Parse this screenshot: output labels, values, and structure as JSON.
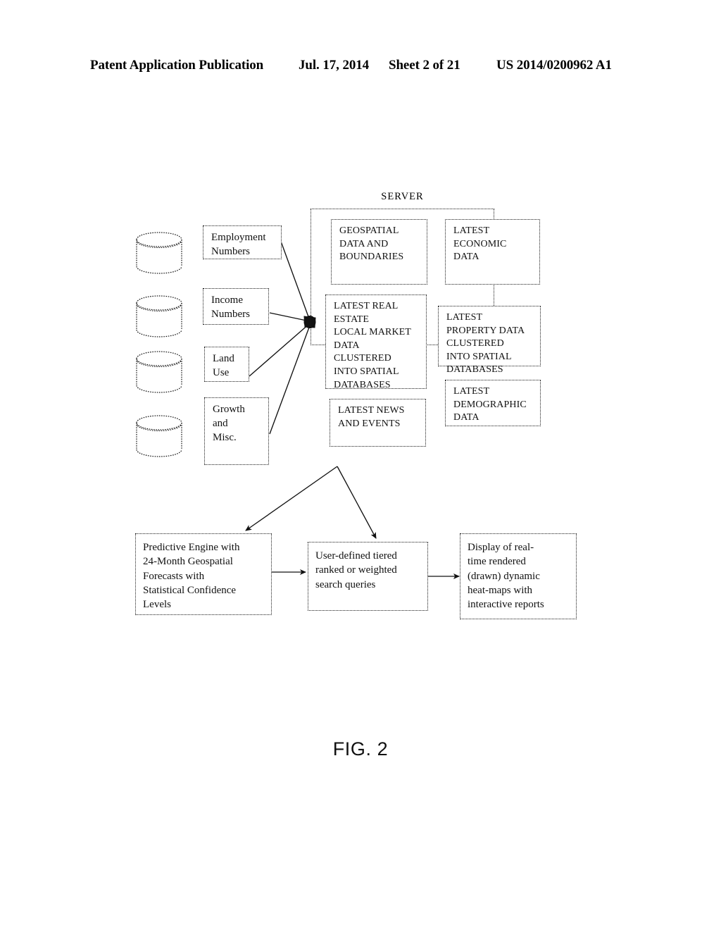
{
  "header": {
    "publication": "Patent Application Publication",
    "date": "Jul. 17, 2014",
    "sheet": "Sheet 2 of 21",
    "patent_number": "US 2014/0200962 A1"
  },
  "figure": {
    "caption": "FIG. 2",
    "server_label": "SERVER"
  },
  "databases": [
    {
      "name": "database-cylinder-1"
    },
    {
      "name": "database-cylinder-2"
    },
    {
      "name": "database-cylinder-3"
    },
    {
      "name": "database-cylinder-4"
    }
  ],
  "sources": [
    {
      "label": "Employment\nNumbers"
    },
    {
      "label": "Income\nNumbers"
    },
    {
      "label": "Land\nUse"
    },
    {
      "label": "Growth\nand\nMisc."
    }
  ],
  "server_nodes": [
    {
      "label": "GEOSPATIAL\nDATA AND\nBOUNDARIES"
    },
    {
      "label": "LATEST\nECONOMIC\nDATA"
    },
    {
      "label": "LATEST REAL\nESTATE\nLOCAL MARKET\nDATA\nCLUSTERED\nINTO SPATIAL\nDATABASES"
    },
    {
      "label": "LATEST\nPROPERTY DATA\nCLUSTERED\nINTO SPATIAL\nDATABASES"
    },
    {
      "label": "LATEST NEWS\nAND EVENTS"
    },
    {
      "label": "LATEST\nDEMOGRAPHIC\nDATA"
    }
  ],
  "flow_nodes": [
    {
      "label": "Predictive Engine with\n24-Month Geospatial\nForecasts with\nStatistical Confidence\nLevels"
    },
    {
      "label": "User-defined tiered\nranked or weighted\nsearch queries"
    },
    {
      "label": "Display of real-\ntime rendered\n(drawn) dynamic\nheat-maps with\ninteractive reports"
    }
  ],
  "colors": {
    "ink": "#111111",
    "paper": "#ffffff"
  }
}
